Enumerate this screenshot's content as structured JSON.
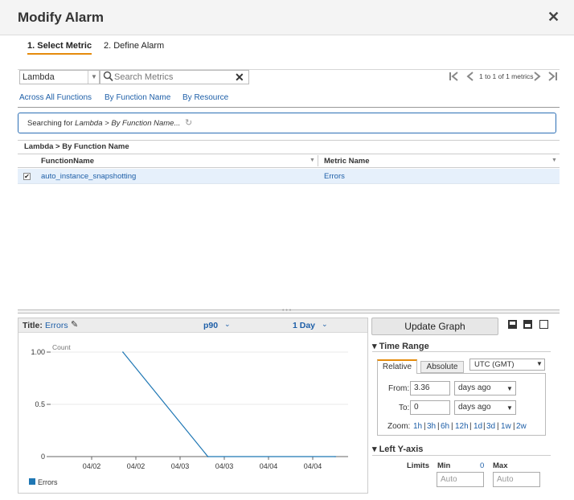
{
  "dialog": {
    "title": "Modify Alarm",
    "close_symbol": "✕"
  },
  "steps": [
    {
      "label": "1. Select Metric",
      "active": true
    },
    {
      "label": "2. Define Alarm",
      "active": false
    }
  ],
  "toolbar": {
    "namespace": "Lambda",
    "search_placeholder": "Search Metrics",
    "pager_text": "1 to 1 of 1 metrics"
  },
  "nav_links": [
    "Across All Functions",
    "By Function Name",
    "By Resource"
  ],
  "search_status": {
    "prefix": "Searching for ",
    "query": "Lambda > By Function Name..."
  },
  "table": {
    "breadcrumb": "Lambda > By Function Name",
    "columns": [
      "FunctionName",
      "Metric Name"
    ],
    "rows": [
      {
        "checked": true,
        "function_name": "auto_instance_snapshotting",
        "metric_name": "Errors"
      }
    ]
  },
  "graph": {
    "title_label": "Title:",
    "title_value": "Errors",
    "statistic": "p90",
    "period": "1 Day"
  },
  "chart_data": {
    "type": "line",
    "ylabel": "Count",
    "ylim": [
      0,
      1.0
    ],
    "y_ticks": [
      "1.00",
      "0.5",
      "0"
    ],
    "x_tick_labels": [
      "04/02",
      "04/02",
      "04/03",
      "04/03",
      "04/04",
      "04/04"
    ],
    "series": [
      {
        "name": "Errors",
        "color": "#1f77b4",
        "x": [
          1.7,
          3.7,
          6.7
        ],
        "values": [
          1.0,
          0.0,
          0.0
        ]
      }
    ]
  },
  "controls": {
    "update_button": "Update Graph",
    "time_range_heading": "Time Range",
    "tabs": [
      "Relative",
      "Absolute"
    ],
    "timezone": "UTC (GMT)",
    "from_label": "From:",
    "from_value": "3.36",
    "from_unit": "days ago",
    "to_label": "To:",
    "to_value": "0",
    "to_unit": "days ago",
    "zoom_label": "Zoom:",
    "zoom_options": [
      "1h",
      "3h",
      "6h",
      "12h",
      "1d",
      "3d",
      "1w",
      "2w"
    ],
    "y_axis_heading": "Left Y-axis",
    "limits_label": "Limits",
    "min_label": "Min",
    "min_hint": "0",
    "max_label": "Max",
    "min_placeholder": "Auto",
    "max_placeholder": "Auto"
  },
  "colors": {
    "accent_orange": "#e58b0c",
    "link_blue": "#1e5fa8",
    "row_selected": "#e6f0fb"
  }
}
